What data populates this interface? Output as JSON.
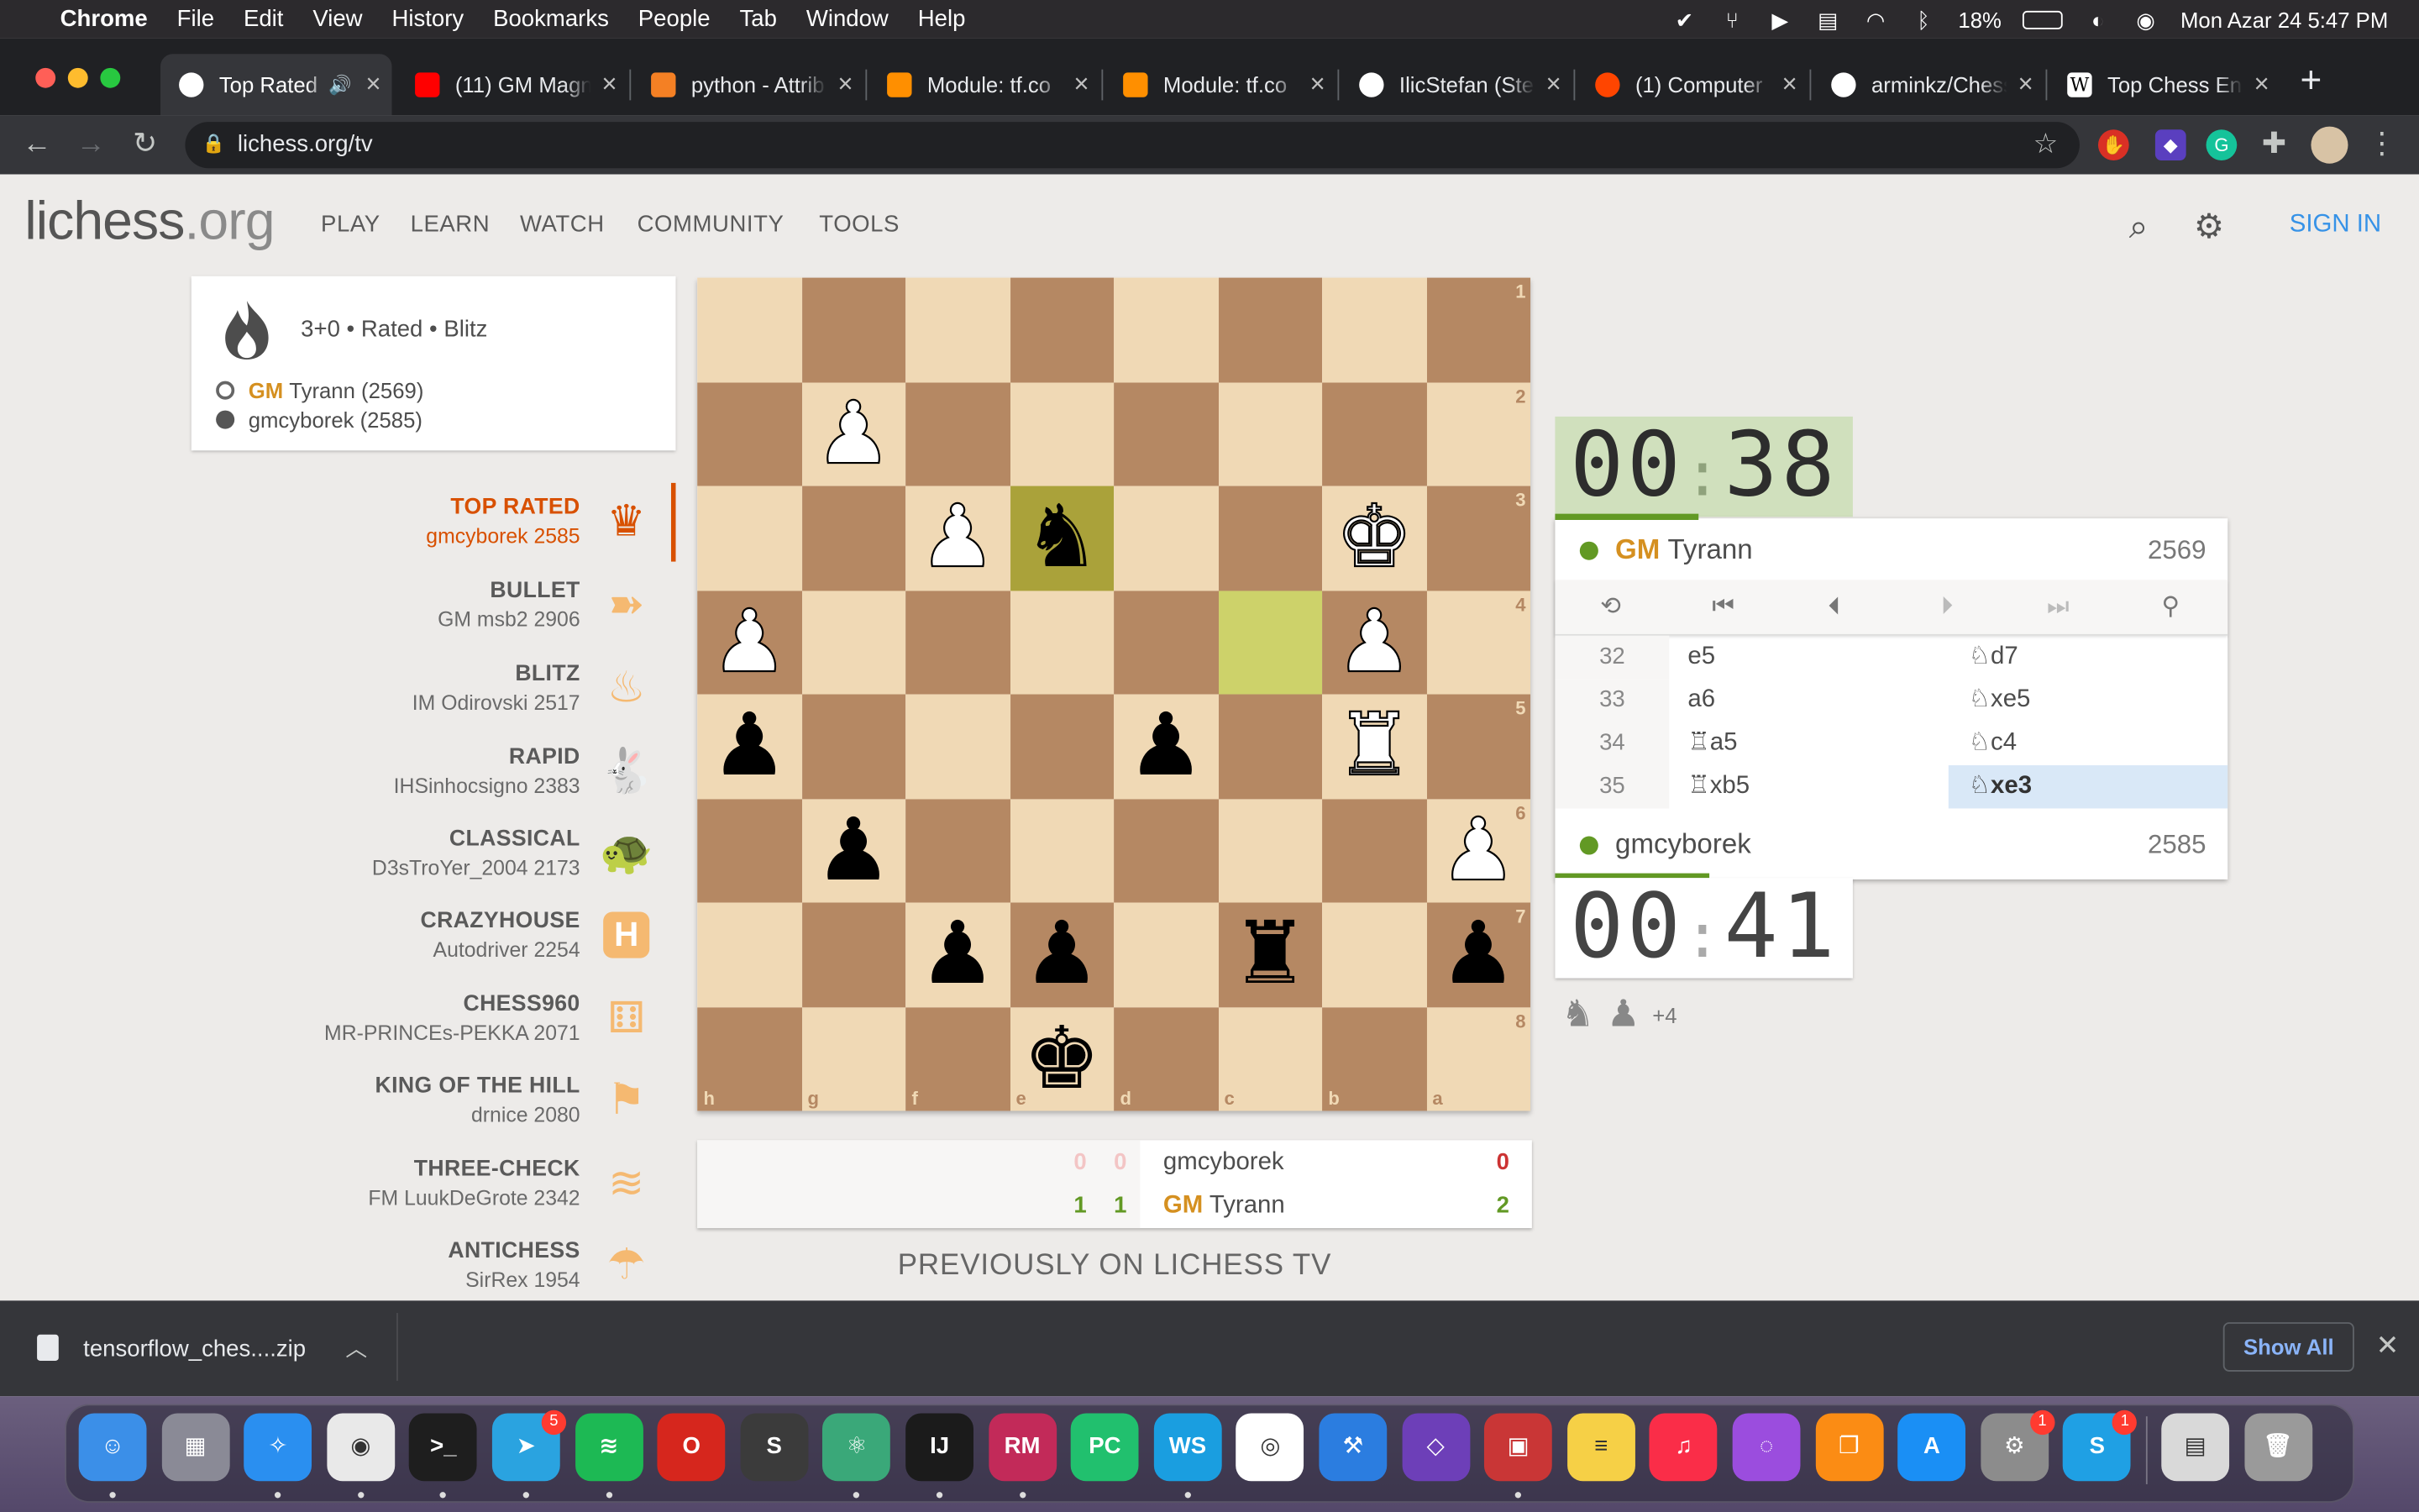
{
  "menubar": {
    "apple": "",
    "app": "Chrome",
    "items": [
      "File",
      "Edit",
      "View",
      "History",
      "Bookmarks",
      "People",
      "Tab",
      "Window",
      "Help"
    ],
    "battery": "18%",
    "datetime": "Mon Azar 24  5:47 PM"
  },
  "tabs": [
    {
      "title": "Top Rated",
      "favicon": "lichess-icon",
      "color": "#ffffff"
    },
    {
      "title": "(11) GM Magnus",
      "favicon": "youtube-icon",
      "color": "#ff0000"
    },
    {
      "title": "python - Attrib",
      "favicon": "stackoverflow-icon",
      "color": "#f48024"
    },
    {
      "title": "Module: tf.co",
      "favicon": "tensorflow-icon",
      "color": "#ff8f00"
    },
    {
      "title": "Module: tf.co",
      "favicon": "tensorflow-icon",
      "color": "#ff8f00"
    },
    {
      "title": "IlicStefan (Ste",
      "favicon": "github-icon",
      "color": "#ffffff"
    },
    {
      "title": "(1) Computer",
      "favicon": "reddit-icon",
      "color": "#ff4500"
    },
    {
      "title": "arminkz/Chess",
      "favicon": "github-icon",
      "color": "#ffffff"
    },
    {
      "title": "Top Chess En",
      "favicon": "wikipedia-icon",
      "color": "#ffffff"
    }
  ],
  "address": {
    "url": "lichess.org/tv"
  },
  "site": {
    "logo_main": "lichess",
    "logo_suffix": ".org",
    "nav": [
      "PLAY",
      "LEARN",
      "WATCH",
      "COMMUNITY",
      "TOOLS"
    ],
    "signin": "SIGN IN"
  },
  "game": {
    "type": "3+0 • Rated • Blitz",
    "white_title": "GM",
    "white_name": "Tyrann (2569)",
    "black_name": "gmcyborek (2585)"
  },
  "channels": [
    {
      "name": "TOP RATED",
      "player": "gmcyborek 2585",
      "icon": "crown-icon",
      "active": true
    },
    {
      "name": "BULLET",
      "player": "GM msb2 2906",
      "icon": "bullet-icon"
    },
    {
      "name": "BLITZ",
      "player": "IM Odirovski 2517",
      "icon": "fire-icon"
    },
    {
      "name": "RAPID",
      "player": "IHSinhocsigno 2383",
      "icon": "rabbit-icon"
    },
    {
      "name": "CLASSICAL",
      "player": "D3sTroYer_2004 2173",
      "icon": "turtle-icon"
    },
    {
      "name": "CRAZYHOUSE",
      "player": "Autodriver 2254",
      "icon": "crazyhouse-icon"
    },
    {
      "name": "CHESS960",
      "player": "MR-PRINCEs-PEKKA 2071",
      "icon": "dice-icon"
    },
    {
      "name": "KING OF THE HILL",
      "player": "drnice 2080",
      "icon": "flag-icon"
    },
    {
      "name": "THREE-CHECK",
      "player": "FM LuukDeGrote 2342",
      "icon": "layers-icon"
    },
    {
      "name": "ANTICHESS",
      "player": "SirRex 1954",
      "icon": "antichess-icon"
    }
  ],
  "board": {
    "orientation": "black",
    "files": [
      "h",
      "g",
      "f",
      "e",
      "d",
      "c",
      "b",
      "a"
    ],
    "ranks": [
      "1",
      "2",
      "3",
      "4",
      "5",
      "6",
      "7",
      "8"
    ],
    "last_move": [
      "e3",
      "c4"
    ],
    "rows": [
      [
        "",
        "",
        "",
        "",
        "",
        "",
        "",
        ""
      ],
      [
        "",
        "P",
        "",
        "",
        "",
        "",
        "",
        ""
      ],
      [
        "",
        "",
        "P",
        "n",
        "",
        "",
        "K",
        ""
      ],
      [
        "P",
        "",
        "",
        "",
        "",
        "",
        "P",
        ""
      ],
      [
        "p",
        "",
        "",
        "",
        "p",
        "",
        "R",
        ""
      ],
      [
        "",
        "p",
        "",
        "",
        "",
        "",
        "",
        "P"
      ],
      [
        "",
        "",
        "p",
        "p",
        "",
        "r",
        "",
        "p"
      ],
      [
        "",
        "",
        "",
        "k",
        "",
        "",
        "",
        ""
      ]
    ]
  },
  "clock": {
    "top_min": "00",
    "top_sec": "38",
    "bottom_min": "00",
    "bottom_sec": "41"
  },
  "players": {
    "top_title": "GM",
    "top_name": "Tyrann",
    "top_rating": "2569",
    "bottom_name": "gmcyborek",
    "bottom_rating": "2585"
  },
  "moves": [
    {
      "n": "32",
      "w": "e5",
      "b": "♘d7"
    },
    {
      "n": "33",
      "w": "a6",
      "b": "♘xe5"
    },
    {
      "n": "34",
      "w": "♖a5",
      "b": "♘c4"
    },
    {
      "n": "35",
      "w": "♖xb5",
      "b": "♘xe3",
      "current": true
    }
  ],
  "material": {
    "extra": "+4"
  },
  "crosstable": {
    "row1": {
      "s1": "0",
      "s2": "0",
      "name": "gmcyborek",
      "total": "0"
    },
    "row2": {
      "s1": "1",
      "s2": "1",
      "title": "GM",
      "name": "Tyrann",
      "total": "2"
    }
  },
  "previously": "PREVIOUSLY ON LICHESS TV",
  "download": {
    "file": "tensorflow_ches....zip",
    "show_all": "Show All"
  },
  "dock": [
    {
      "app": "Finder",
      "glyph": "☺",
      "color": "#3b8fe8"
    },
    {
      "app": "Launchpad",
      "glyph": "▦",
      "color": "#8a8a96"
    },
    {
      "app": "Safari",
      "glyph": "✧",
      "color": "#2a8ff0"
    },
    {
      "app": "Chrome",
      "glyph": "◉",
      "color": "#e9e9e9"
    },
    {
      "app": "Terminal",
      "glyph": ">_",
      "color": "#1e1e1e"
    },
    {
      "app": "Telegram",
      "glyph": "➤",
      "color": "#2aa3e0",
      "badge": "5"
    },
    {
      "app": "Spotify",
      "glyph": "≋",
      "color": "#1db954"
    },
    {
      "app": "Opera",
      "glyph": "O",
      "color": "#d6261d"
    },
    {
      "app": "Sublime Text",
      "glyph": "S",
      "color": "#3b3b3b"
    },
    {
      "app": "Atom",
      "glyph": "⚛",
      "color": "#3aa879"
    },
    {
      "app": "IntelliJ IDEA",
      "glyph": "IJ",
      "color": "#1b1b1b"
    },
    {
      "app": "RubyMine",
      "glyph": "RM",
      "color": "#c22a59"
    },
    {
      "app": "PyCharm",
      "glyph": "PC",
      "color": "#21c06e"
    },
    {
      "app": "WebStorm",
      "glyph": "WS",
      "color": "#1a9ee0"
    },
    {
      "app": "Anaconda",
      "glyph": "◎",
      "color": "#ffffff"
    },
    {
      "app": "Xcode",
      "glyph": "⚒",
      "color": "#2b7de0"
    },
    {
      "app": "Visual Studio",
      "glyph": "◇",
      "color": "#6d3fb8"
    },
    {
      "app": "Parallels",
      "glyph": "▣",
      "color": "#c93636"
    },
    {
      "app": "Notes",
      "glyph": "≡",
      "color": "#f6d046"
    },
    {
      "app": "Music",
      "glyph": "♫",
      "color": "#fa2d48"
    },
    {
      "app": "Podcasts",
      "glyph": "◌",
      "color": "#9b4dde"
    },
    {
      "app": "Books",
      "glyph": "❐",
      "color": "#fb8c14"
    },
    {
      "app": "App Store",
      "glyph": "A",
      "color": "#1a8ff5"
    },
    {
      "app": "System Preferences",
      "glyph": "⚙",
      "color": "#8c8c8c",
      "badge": "1"
    },
    {
      "app": "Skype",
      "glyph": "S",
      "color": "#1fa0e4",
      "badge": "1"
    },
    {
      "app": "Documents",
      "glyph": "▤",
      "color": "#d9d9d9"
    },
    {
      "app": "Trash",
      "glyph": "🗑",
      "color": "#9a9a9a"
    }
  ]
}
